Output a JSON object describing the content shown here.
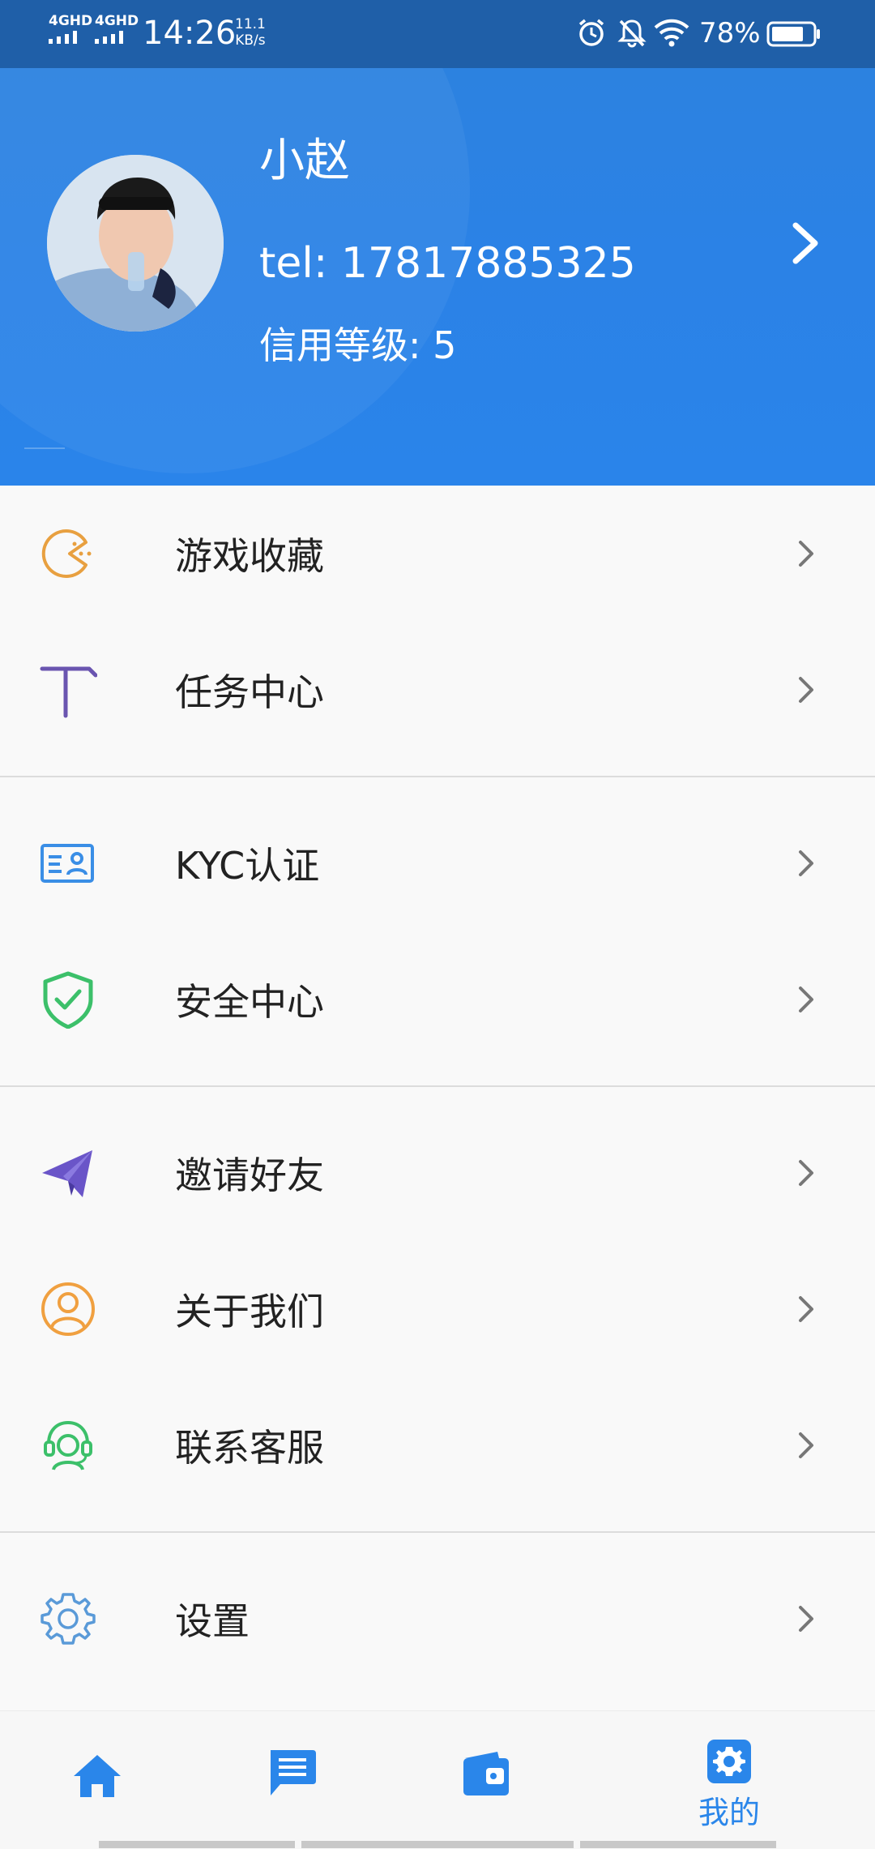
{
  "status_bar": {
    "network_1": "4GHD",
    "network_2": "4GHD",
    "time": "14:26",
    "speed_value": "11.1",
    "speed_unit": "KB/s",
    "battery_percent": "78%",
    "icons": [
      "alarm-icon",
      "mute-icon",
      "wifi-icon",
      "battery-icon"
    ]
  },
  "profile": {
    "name": "小赵",
    "phone": "tel: 17817885325",
    "credit_level": "信用等级: 5"
  },
  "menu": {
    "groups": [
      {
        "items": [
          {
            "label": "游戏收藏",
            "icon": "pacman-icon",
            "color": "#e8a040"
          },
          {
            "label": "任务中心",
            "icon": "task-t-icon",
            "color": "#6a55b0"
          }
        ]
      },
      {
        "items": [
          {
            "label": "KYC认证",
            "icon": "id-card-icon",
            "color": "#3a8ee6"
          },
          {
            "label": "安全中心",
            "icon": "shield-check-icon",
            "color": "#3cc06a"
          }
        ]
      },
      {
        "items": [
          {
            "label": "邀请好友",
            "icon": "paper-plane-icon",
            "color": "#6a55c8"
          },
          {
            "label": "关于我们",
            "icon": "user-circle-icon",
            "color": "#f0a040"
          },
          {
            "label": "联系客服",
            "icon": "headset-icon",
            "color": "#3cc06a"
          }
        ]
      },
      {
        "items": [
          {
            "label": "设置",
            "icon": "gear-icon",
            "color": "#5a9ad8"
          }
        ]
      }
    ]
  },
  "bottom_nav": {
    "items": [
      {
        "icon": "home-icon",
        "label": ""
      },
      {
        "icon": "message-icon",
        "label": ""
      },
      {
        "icon": "wallet-icon",
        "label": ""
      },
      {
        "icon": "settings-icon",
        "label": "我的"
      }
    ],
    "active_color": "#2a86ea"
  }
}
